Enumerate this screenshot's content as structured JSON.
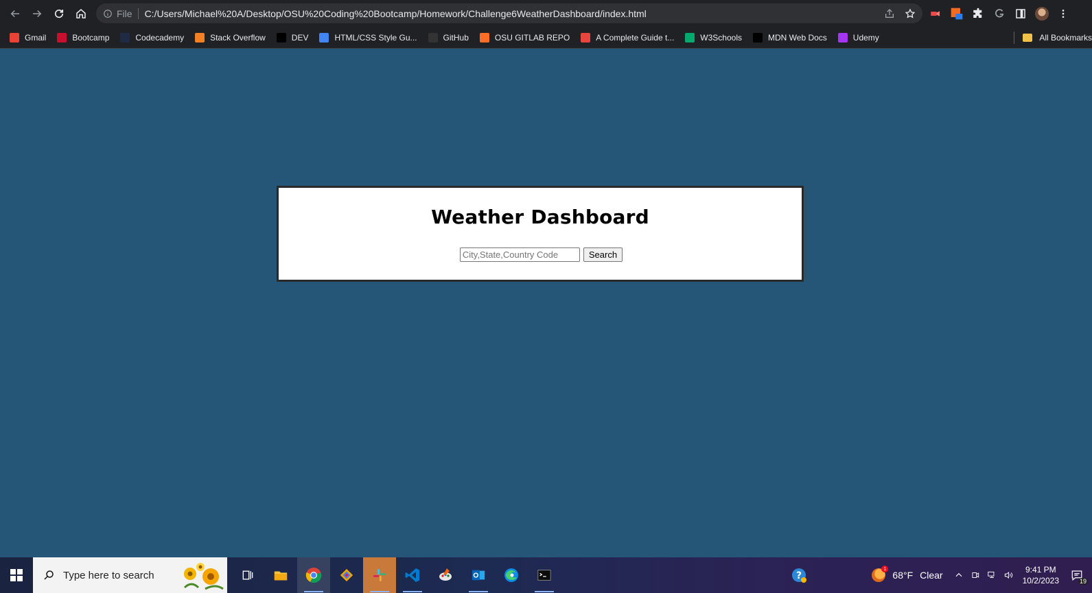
{
  "browser": {
    "file_label": "File",
    "url": "C:/Users/Michael%20A/Desktop/OSU%20Coding%20Bootcamp/Homework/Challenge6WeatherDashboard/index.html"
  },
  "bookmarks": [
    {
      "label": "Gmail",
      "icon": "gmail-icon",
      "color": "#ea4335"
    },
    {
      "label": "Bootcamp",
      "icon": "bootcamp-icon",
      "color": "#c8102e"
    },
    {
      "label": "Codecademy",
      "icon": "codecademy-icon",
      "color": "#1f2a44"
    },
    {
      "label": "Stack Overflow",
      "icon": "stackoverflow-icon",
      "color": "#f48024"
    },
    {
      "label": "DEV",
      "icon": "dev-icon",
      "color": "#000000"
    },
    {
      "label": "HTML/CSS Style Gu...",
      "icon": "google-icon",
      "color": "#4285f4"
    },
    {
      "label": "GitHub",
      "icon": "github-icon",
      "color": "#333333"
    },
    {
      "label": "OSU GITLAB REPO",
      "icon": "gitlab-icon",
      "color": "#fc6d26"
    },
    {
      "label": "A Complete Guide t...",
      "icon": "css-tricks-icon",
      "color": "#e8453c"
    },
    {
      "label": "W3Schools",
      "icon": "w3schools-icon",
      "color": "#04aa6d"
    },
    {
      "label": "MDN Web Docs",
      "icon": "mdn-icon",
      "color": "#000000"
    },
    {
      "label": "Udemy",
      "icon": "udemy-icon",
      "color": "#a435f0"
    }
  ],
  "all_bookmarks_label": "All Bookmarks",
  "page": {
    "title": "Weather Dashboard",
    "search_placeholder": "City,State,Country Code",
    "search_button": "Search",
    "background": "#255678"
  },
  "taskbar": {
    "search_placeholder": "Type here to search",
    "weather_temp": "68°F",
    "weather_desc": "Clear",
    "weather_badge": "1",
    "time": "9:41 PM",
    "date": "10/2/2023",
    "notifications": "19"
  }
}
